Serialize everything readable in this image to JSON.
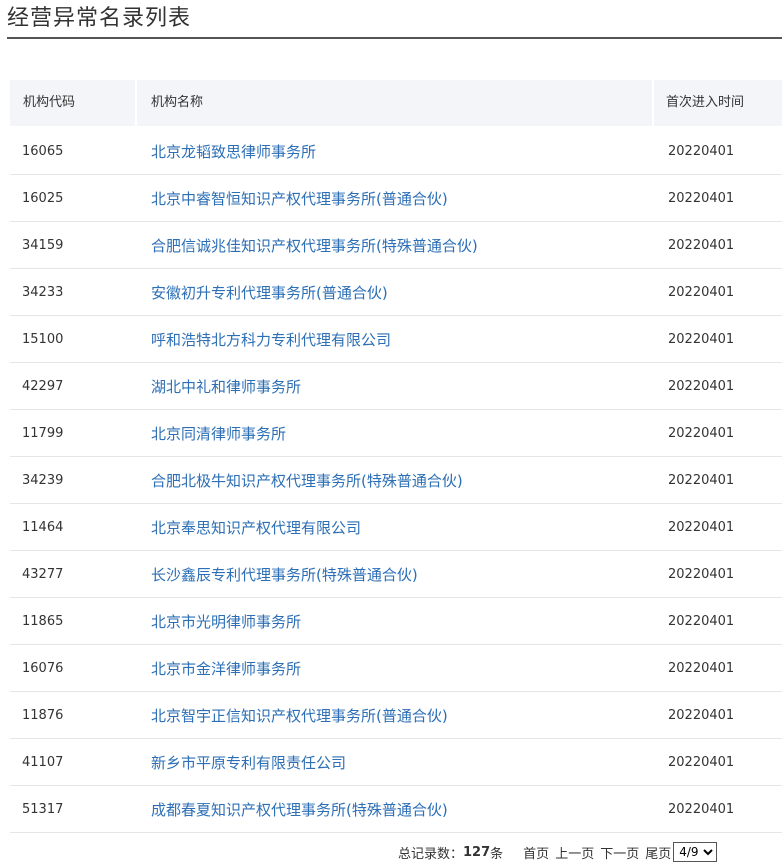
{
  "page": {
    "title": "经营异常名录列表"
  },
  "table": {
    "headers": [
      "机构代码",
      "机构名称",
      "首次进入时间"
    ],
    "rows": [
      {
        "code": "16065",
        "name": "北京龙韬致思律师事务所",
        "date": "20220401"
      },
      {
        "code": "16025",
        "name": "北京中睿智恒知识产权代理事务所(普通合伙)",
        "date": "20220401"
      },
      {
        "code": "34159",
        "name": "合肥信诚兆佳知识产权代理事务所(特殊普通合伙)",
        "date": "20220401"
      },
      {
        "code": "34233",
        "name": "安徽初升专利代理事务所(普通合伙)",
        "date": "20220401"
      },
      {
        "code": "15100",
        "name": "呼和浩特北方科力专利代理有限公司",
        "date": "20220401"
      },
      {
        "code": "42297",
        "name": "湖北中礼和律师事务所",
        "date": "20220401"
      },
      {
        "code": "11799",
        "name": "北京同清律师事务所",
        "date": "20220401"
      },
      {
        "code": "34239",
        "name": "合肥北极牛知识产权代理事务所(特殊普通合伙)",
        "date": "20220401"
      },
      {
        "code": "11464",
        "name": "北京奉思知识产权代理有限公司",
        "date": "20220401"
      },
      {
        "code": "43277",
        "name": "长沙鑫辰专利代理事务所(特殊普通合伙)",
        "date": "20220401"
      },
      {
        "code": "11865",
        "name": "北京市光明律师事务所",
        "date": "20220401"
      },
      {
        "code": "16076",
        "name": "北京市金洋律师事务所",
        "date": "20220401"
      },
      {
        "code": "11876",
        "name": "北京智宇正信知识产权代理事务所(普通合伙)",
        "date": "20220401"
      },
      {
        "code": "41107",
        "name": "新乡市平原专利有限责任公司",
        "date": "20220401"
      },
      {
        "code": "51317",
        "name": "成都春夏知识产权代理事务所(特殊普通合伙)",
        "date": "20220401"
      }
    ]
  },
  "pager": {
    "total_label": "总记录数：",
    "total_count": "127",
    "total_unit": "条",
    "first": "首页",
    "prev": "上一页",
    "next": "下一页",
    "last": "尾页",
    "page_select": "4/9"
  }
}
